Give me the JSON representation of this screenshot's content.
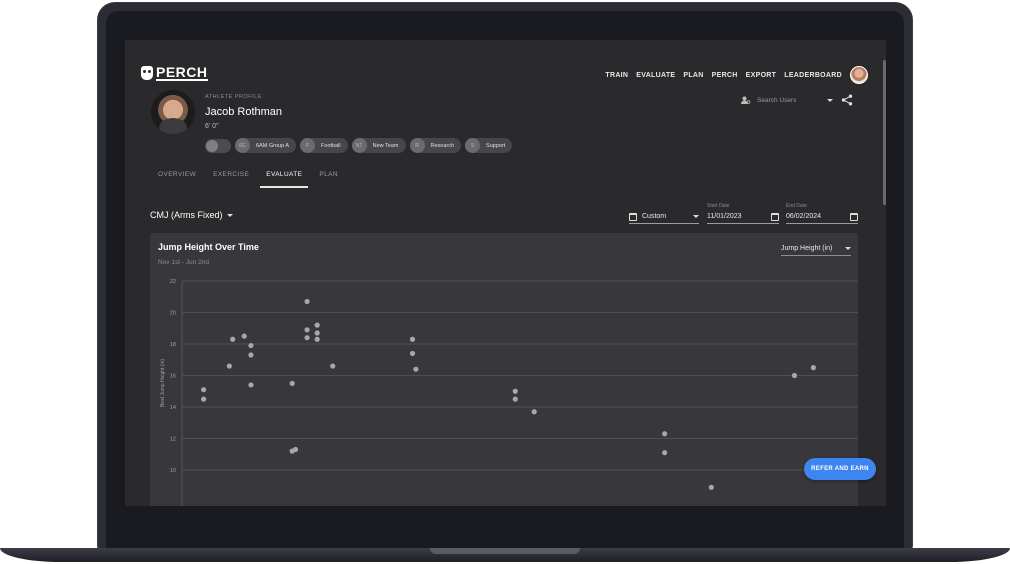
{
  "app": {
    "logo_text": "PERCH"
  },
  "nav": {
    "items": [
      "TRAIN",
      "EVALUATE",
      "PLAN",
      "PERCH",
      "EXPORT",
      "LEADERBOARD"
    ]
  },
  "profile": {
    "label": "ATHLETE PROFILE",
    "name": "Jacob Rothman",
    "height": "6' 0\"",
    "tags": [
      {
        "initials": "6G",
        "label": "6AM Group A"
      },
      {
        "initials": "F",
        "label": "Football"
      },
      {
        "initials": "NT",
        "label": "New Team"
      },
      {
        "initials": "R",
        "label": "Research"
      },
      {
        "initials": "S",
        "label": "Support"
      }
    ]
  },
  "search": {
    "placeholder": "Search Users"
  },
  "tabs": [
    "OVERVIEW",
    "EXERCISE",
    "EVALUATE",
    "PLAN"
  ],
  "active_tab": "EVALUATE",
  "filters": {
    "exercise": "CMJ (Arms Fixed)",
    "range": "Custom",
    "start_label": "Start Date",
    "start_value": "11/01/2023",
    "end_label": "End Date",
    "end_value": "06/02/2024"
  },
  "chart_card": {
    "title": "Jump Height Over Time",
    "subtitle": "Nov 1st - Jun 2nd",
    "metric": "Jump Height (in)"
  },
  "chart_data": {
    "type": "scatter",
    "ylabel": "Best Jump Height (in)",
    "yticks": [
      10,
      12,
      14,
      16,
      18,
      20,
      22
    ],
    "ylim": [
      9,
      22
    ],
    "xlim": [
      0,
      100
    ],
    "grid": true,
    "points": [
      {
        "x": 3.2,
        "y": 15.1
      },
      {
        "x": 3.2,
        "y": 14.5
      },
      {
        "x": 7.0,
        "y": 16.6
      },
      {
        "x": 7.5,
        "y": 18.3
      },
      {
        "x": 9.2,
        "y": 18.5
      },
      {
        "x": 10.2,
        "y": 17.9
      },
      {
        "x": 10.2,
        "y": 17.3
      },
      {
        "x": 10.2,
        "y": 15.4
      },
      {
        "x": 16.3,
        "y": 15.5
      },
      {
        "x": 16.3,
        "y": 11.2
      },
      {
        "x": 16.8,
        "y": 11.3
      },
      {
        "x": 18.5,
        "y": 20.7
      },
      {
        "x": 18.5,
        "y": 18.9
      },
      {
        "x": 18.5,
        "y": 18.4
      },
      {
        "x": 20.0,
        "y": 19.2
      },
      {
        "x": 20.0,
        "y": 18.7
      },
      {
        "x": 20.0,
        "y": 18.3
      },
      {
        "x": 22.3,
        "y": 16.6
      },
      {
        "x": 34.1,
        "y": 18.3
      },
      {
        "x": 34.1,
        "y": 17.4
      },
      {
        "x": 34.6,
        "y": 16.4
      },
      {
        "x": 49.3,
        "y": 15.0
      },
      {
        "x": 49.3,
        "y": 14.5
      },
      {
        "x": 52.1,
        "y": 13.7
      },
      {
        "x": 71.4,
        "y": 12.3
      },
      {
        "x": 71.4,
        "y": 11.1
      },
      {
        "x": 78.3,
        "y": 8.9
      },
      {
        "x": 90.6,
        "y": 16.0
      },
      {
        "x": 93.4,
        "y": 16.5
      }
    ]
  },
  "cta": {
    "refer_label": "REFER AND EARN"
  }
}
